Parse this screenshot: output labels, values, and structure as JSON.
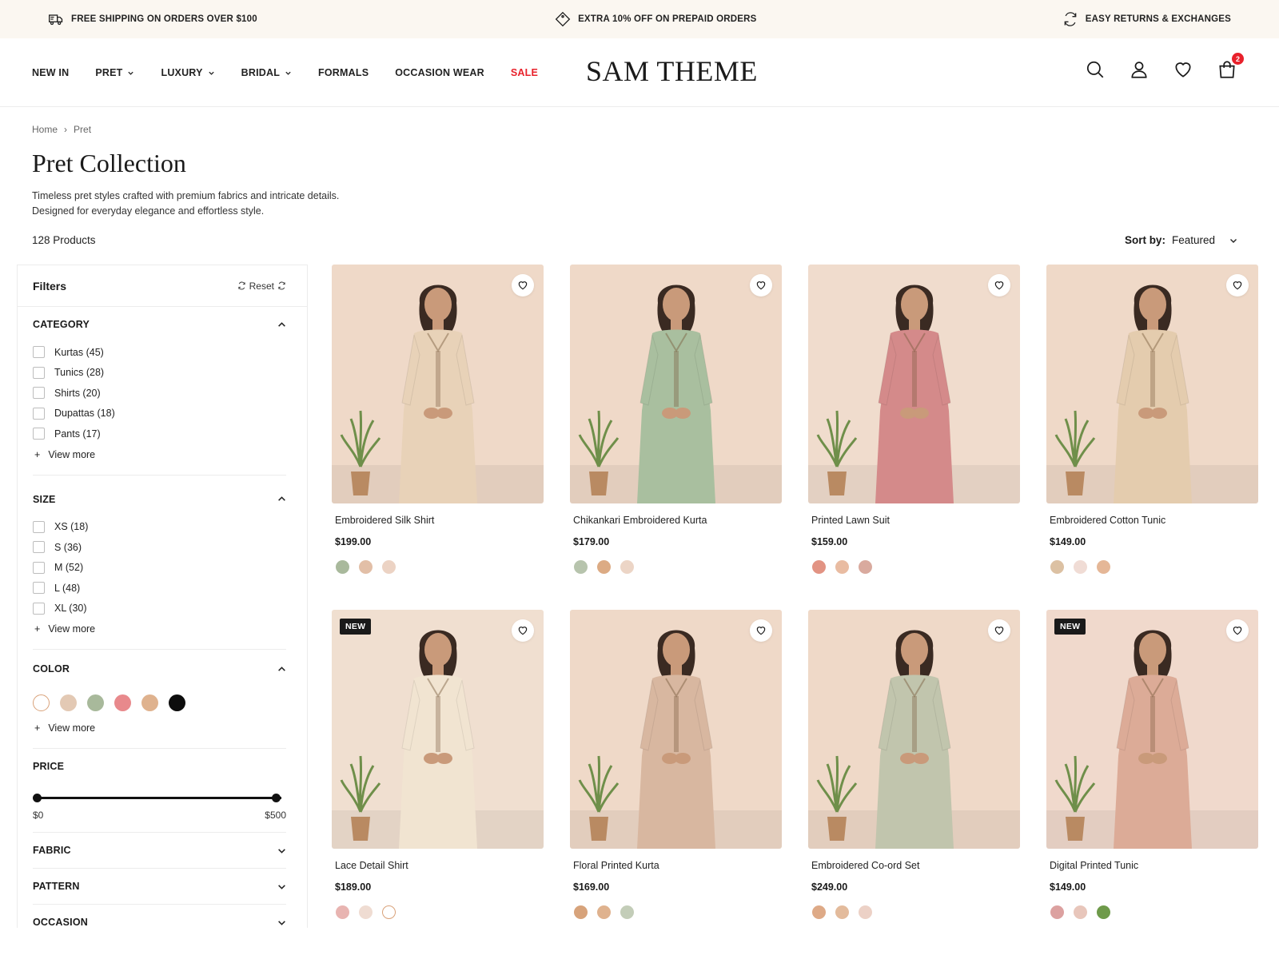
{
  "promo": [
    {
      "icon": "truck-icon",
      "text": "FREE SHIPPING ON ORDERS OVER $100"
    },
    {
      "icon": "tag-icon",
      "text": "EXTRA 10% OFF ON PREPAID ORDERS"
    },
    {
      "icon": "refresh-icon",
      "text": "EASY RETURNS & EXCHANGES"
    }
  ],
  "nav": [
    {
      "label": "NEW IN",
      "dropdown": false,
      "sale": false
    },
    {
      "label": "PRET",
      "dropdown": true,
      "sale": false
    },
    {
      "label": "LUXURY",
      "dropdown": true,
      "sale": false
    },
    {
      "label": "BRIDAL",
      "dropdown": true,
      "sale": false
    },
    {
      "label": "FORMALS",
      "dropdown": false,
      "sale": false
    },
    {
      "label": "OCCASION WEAR",
      "dropdown": false,
      "sale": false
    },
    {
      "label": "SALE",
      "dropdown": false,
      "sale": true
    }
  ],
  "brand": {
    "logo": "SAM THEME",
    "sale_color": "#e8212b"
  },
  "header_icons": [
    "search-icon",
    "user-icon",
    "heart-icon",
    "bag-icon"
  ],
  "cart": {
    "count": "2"
  },
  "breadcrumb": {
    "home": "Home",
    "sep": "›",
    "current": "Pret"
  },
  "page": {
    "title": "Pret Collection",
    "desc_line1": "Timeless pret styles crafted with premium fabrics and intricate details.",
    "desc_line2": "Designed for everyday elegance and effortless style.",
    "count": "128 Products"
  },
  "sort": {
    "label": "Sort by:",
    "value": "Featured"
  },
  "filters": {
    "title": "Filters",
    "reset": "Reset",
    "category": {
      "title": "CATEGORY",
      "options": [
        "Kurtas (45)",
        "Tunics (28)",
        "Shirts (20)",
        "Dupattas (18)",
        "Pants (17)"
      ],
      "more": "View more"
    },
    "size": {
      "title": "SIZE",
      "options": [
        "XS (18)",
        "S (36)",
        "M (52)",
        "L (48)",
        "XL (30)"
      ],
      "more": "View more"
    },
    "color": {
      "title": "COLOR",
      "swatches": [
        "#ffffff",
        "#e3c9b4",
        "#a8b99b",
        "#e8898c",
        "#dfb28e",
        "#0d0d0d"
      ],
      "more": "View more"
    },
    "price": {
      "title": "PRICE",
      "min": "$0",
      "max": "$500",
      "low_fraction": 0,
      "high_fraction": 1
    },
    "collapsed": [
      "FABRIC",
      "PATTERN",
      "OCCASION"
    ]
  },
  "products": [
    {
      "name": "Embroidered Silk Shirt",
      "price": "$199.00",
      "badge": "",
      "dress": "#e8d2b8",
      "wall": "#efd9c8",
      "colors": [
        "#a9b99c",
        "#e2bfa7",
        "#ecd3c4"
      ]
    },
    {
      "name": "Chikankari Embroidered Kurta",
      "price": "$179.00",
      "badge": "",
      "dress": "#a9bf9f",
      "wall": "#efd9c8",
      "colors": [
        "#b7c4ad",
        "#dcab84",
        "#ecd5c6"
      ]
    },
    {
      "name": "Printed Lawn Suit",
      "price": "$159.00",
      "badge": "",
      "dress": "#d48a8a",
      "wall": "#f0dccd",
      "colors": [
        "#e29383",
        "#e9bca2",
        "#d9aa9e"
      ]
    },
    {
      "name": "Embroidered Cotton Tunic",
      "price": "$149.00",
      "badge": "",
      "dress": "#e4ccae",
      "wall": "#efd9c8",
      "colors": [
        "#dcc1a3",
        "#f0dcd5",
        "#e5b797"
      ]
    },
    {
      "name": "Lace Detail Shirt",
      "price": "$189.00",
      "badge": "NEW",
      "dress": "#f1e4d1",
      "wall": "#f0dfd0",
      "colors": [
        "#e8b4b1",
        "#efdcd2",
        "#ffffff"
      ]
    },
    {
      "name": "Floral Printed Kurta",
      "price": "$169.00",
      "badge": "",
      "dress": "#d8b7a0",
      "wall": "#efd9c8",
      "colors": [
        "#d7a37b",
        "#dfb28e",
        "#c3cdb8"
      ]
    },
    {
      "name": "Embroidered Co-ord Set",
      "price": "$249.00",
      "badge": "",
      "dress": "#c1c5ad",
      "wall": "#efd9c8",
      "colors": [
        "#deaa87",
        "#e3bb9c",
        "#ecd1c6"
      ]
    },
    {
      "name": "Digital Printed Tunic",
      "price": "$149.00",
      "badge": "NEW",
      "dress": "#dcab97",
      "wall": "#f0d9cc",
      "colors": [
        "#dca1a0",
        "#e8c6bb",
        "#6e9a4a"
      ]
    }
  ]
}
